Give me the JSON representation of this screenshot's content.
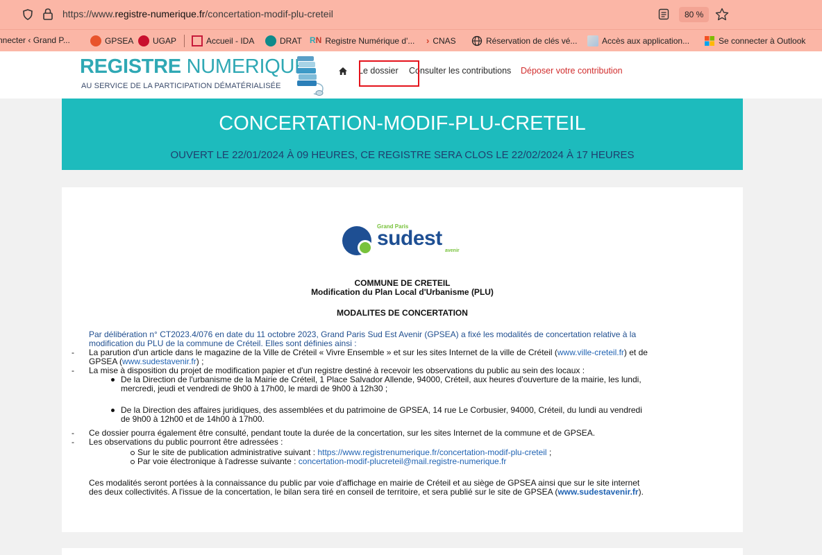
{
  "browser": {
    "url_prefix": "https://www.",
    "url_domain": "registre-numerique.fr",
    "url_path": "/concertation-modif-plu-creteil",
    "zoom": "80 %",
    "bookmarks": [
      {
        "label": "nnecter ‹ Grand P...",
        "icon": "wordpress-icon"
      },
      {
        "label": "GPSEA",
        "icon": "gpsea-icon"
      },
      {
        "label": "UGAP",
        "icon": "ugap-icon"
      },
      {
        "label": "Accueil - IDA",
        "icon": "ida-icon"
      },
      {
        "label": "DRAT",
        "icon": "sharepoint-icon"
      },
      {
        "label": "Registre Numérique d'...",
        "icon": "rn-icon"
      },
      {
        "label": "CNAS",
        "icon": "cnas-icon"
      },
      {
        "label": "Réservation de clés vé...",
        "icon": "globe-icon"
      },
      {
        "label": "Accès aux application...",
        "icon": "apps-icon"
      },
      {
        "label": "Se connecter à Outlook",
        "icon": "microsoft-icon"
      }
    ]
  },
  "site": {
    "logo_word1": "REGISTRE",
    "logo_word2": "NUMERIQUE",
    "logo_tagline": "AU SERVICE DE LA PARTICIPATION DÉMATÉRIALISÉE",
    "nav": {
      "dossier": "Le dossier",
      "consulter": "Consulter les contributions",
      "deposer": "Déposer votre contribution"
    },
    "colors": {
      "accent": "#1dbbbd",
      "deposer": "#d12d2d",
      "highlight": "#e4121b"
    }
  },
  "banner": {
    "title": "CONCERTATION-MODIF-PLU-CRETEIL",
    "subtitle": "OUVERT LE 22/01/2024 À 09 HEURES, CE REGISTRE SERA CLOS LE 22/02/2024 À 17 HEURES"
  },
  "document": {
    "logo_small": "Grand Paris",
    "logo_big": "sudest",
    "logo_avenir": "avenir",
    "heading1": "COMMUNE DE CRETEIL",
    "heading2": "Modification du Plan Local d'Urbanisme (PLU)",
    "heading3": "MODALITES DE CONCERTATION",
    "intro_line1": "Par délibération n° CT2023.4/076 en date du 11 octobre 2023, Grand Paris Sud Est Avenir (GPSEA) a fixé les modalités de concertation relative à la",
    "intro_line2": "modification du PLU de la commune de Créteil. Elles sont définies ainsi :",
    "item1_line1_a": "La parution d'un article dans le magazine de la Ville de Créteil « Vivre Ensemble » et sur les sites Internet de la ville de Créteil (",
    "item1_link1": "www.ville-creteil.fr",
    "item1_line1_b": ") et de",
    "item1_line2_a": "GPSEA (",
    "item1_link2": "www.sudestavenir.fr",
    "item1_line2_b": ") ;",
    "item2": "La mise à disposition du projet de modification papier et d'un registre destiné à recevoir les observations du public au sein des locaux :",
    "sub1_line1": "De la Direction de l'urbanisme de la Mairie de Créteil, 1 Place Salvador Allende, 94000, Créteil, aux heures d'ouverture de la mairie, les lundi,",
    "sub1_line2": "mercredi, jeudi et vendredi de 9h00 à 17h00, le mardi de 9h00 à 12h30 ;",
    "sub2_line1": "De la Direction des affaires juridiques, des assemblées et du patrimoine de GPSEA, 14 rue Le Corbusier, 94000, Créteil, du lundi au vendredi",
    "sub2_line2": "de 9h00 à 12h00 et de 14h00 à 17h00.",
    "item3": "Ce dossier pourra également être consulté, pendant toute la durée de la concertation, sur les sites Internet de la commune et de GPSEA.",
    "item4": "Les observations du public pourront être adressées :",
    "obs1_a": "Sur le site de publication administrative suivant : ",
    "obs1_link": "https://www.registrenumerique.fr/concertation-modif-plu-creteil",
    "obs1_b": " ;",
    "obs2_a": "Par voie électronique à l'adresse suivante : ",
    "obs2_link": "concertation-modif-plucreteil@mail.registre-numerique.fr",
    "closing_line1": "Ces modalités seront portées à la connaissance du public par voie d'affichage en mairie de Créteil et au siège de GPSEA ainsi que sur le site internet",
    "closing_line2_a": "des deux collectivités. A l'issue de la concertation, le bilan sera tiré en conseil de territoire, et sera publié sur le site de GPSEA (",
    "closing_link": "www.sudestavenir.fr",
    "closing_line2_b": ")."
  }
}
